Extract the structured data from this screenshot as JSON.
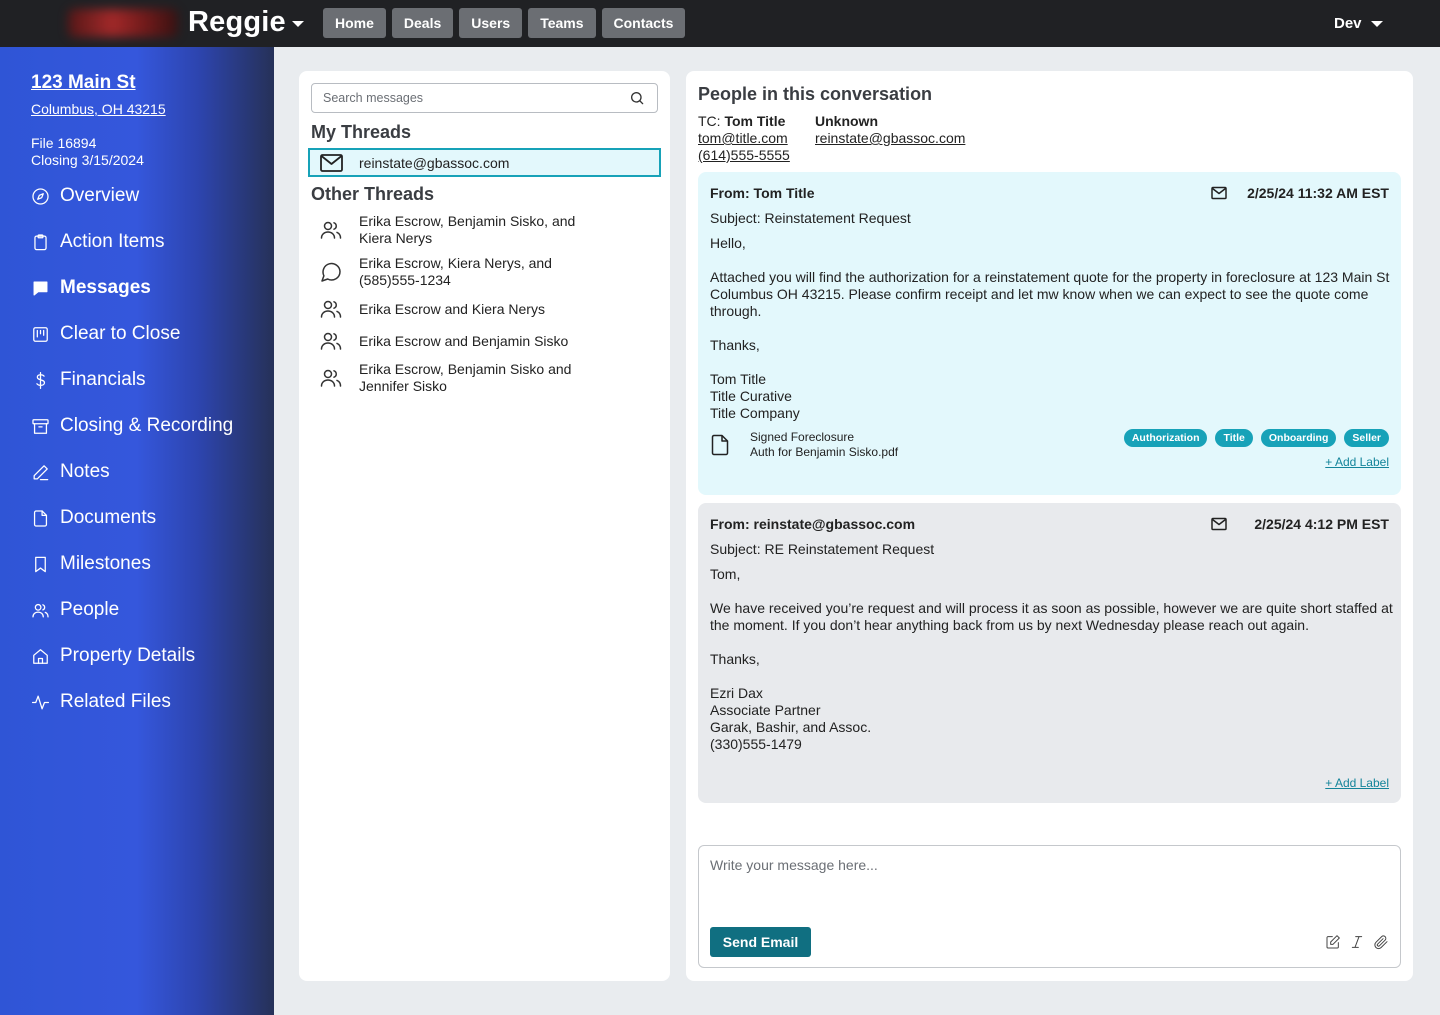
{
  "app": {
    "brand": "Reggie",
    "user_menu": "Dev"
  },
  "nav": {
    "items": [
      "Home",
      "Deals",
      "Users",
      "Teams",
      "Contacts"
    ]
  },
  "property": {
    "address_line1": "123 Main St",
    "address_line2": "Columbus, OH 43215",
    "file": "File 16894",
    "closing": "Closing 3/15/2024"
  },
  "sidebar": {
    "items": [
      {
        "label": "Overview",
        "icon": "compass-icon"
      },
      {
        "label": "Action Items",
        "icon": "clipboard-icon"
      },
      {
        "label": "Messages",
        "icon": "chat-bubble-icon",
        "active": true
      },
      {
        "label": "Clear to Close",
        "icon": "kanban-icon"
      },
      {
        "label": "Financials",
        "icon": "dollar-icon"
      },
      {
        "label": "Closing & Recording",
        "icon": "archive-icon"
      },
      {
        "label": "Notes",
        "icon": "pencil-icon"
      },
      {
        "label": "Documents",
        "icon": "file-icon"
      },
      {
        "label": "Milestones",
        "icon": "bookmark-icon"
      },
      {
        "label": "People",
        "icon": "people-icon"
      },
      {
        "label": "Property Details",
        "icon": "home-icon"
      },
      {
        "label": "Related Files",
        "icon": "activity-icon"
      }
    ]
  },
  "threads": {
    "search_placeholder": "Search messages",
    "my_title": "My Threads",
    "my": [
      "reinstate@gbassoc.com"
    ],
    "other_title": "Other Threads",
    "other": [
      {
        "label": "Erika Escrow, Benjamin Sisko, and Kiera Nerys",
        "icon": "people-icon"
      },
      {
        "label": "Erika Escrow, Kiera Nerys, and (585)555-1234",
        "icon": "chat-bubble-icon"
      },
      {
        "label": "Erika Escrow and Kiera Nerys",
        "icon": "people-icon"
      },
      {
        "label": "Erika Escrow and Benjamin Sisko",
        "icon": "people-icon"
      },
      {
        "label": "Erika Escrow, Benjamin Sisko and Jennifer Sisko",
        "icon": "people-icon"
      }
    ]
  },
  "conversation": {
    "title": "People in this conversation",
    "people": [
      {
        "role": "TC:",
        "name": "Tom Title",
        "email": "tom@title.com",
        "phone": "(614)555-5555"
      },
      {
        "role": "",
        "name": "Unknown",
        "email": "reinstate@gbassoc.com",
        "phone": ""
      }
    ],
    "messages": [
      {
        "from": "From: Tom Title",
        "date": "2/25/24 11:32 AM EST",
        "subject": "Subject: Reinstatement Request",
        "body": [
          "Hello,",
          "",
          "Attached you will find the authorization for a reinstatement quote for the property in foreclosure at 123 Main St Columbus OH 43215. Please confirm receipt and let mw know when we can expect to see the quote come through.",
          "",
          "Thanks,",
          "",
          "Tom Title",
          "Title Curative",
          "Title Company"
        ],
        "attachment": {
          "line1": "Signed Foreclosure",
          "line2": "Auth for Benjamin Sisko.pdf"
        },
        "labels": [
          "Authorization",
          "Title",
          "Onboarding",
          "Seller"
        ],
        "add_label": "+ Add Label"
      },
      {
        "from": "From: reinstate@gbassoc.com",
        "date": "2/25/24 4:12 PM EST",
        "subject": "Subject: RE Reinstatement Request",
        "body": [
          "Tom,",
          "",
          "We have received you’re request and will process it as soon as possible, however we are quite short staffed at the moment. If you don’t hear anything back from us by next Wednesday please reach out again.",
          "",
          "Thanks,",
          "",
          "Ezri Dax",
          "Associate Partner",
          "Garak, Bashir, and Assoc.",
          "(330)555-1479"
        ],
        "add_label": "+ Add Label"
      }
    ],
    "composer": {
      "placeholder": "Write your message here...",
      "send_label": "Send Email"
    }
  },
  "colors": {
    "accent": "#17a2b8",
    "primary_button": "#106f81",
    "sidebar": "#3557dc",
    "topbar": "#202124"
  }
}
